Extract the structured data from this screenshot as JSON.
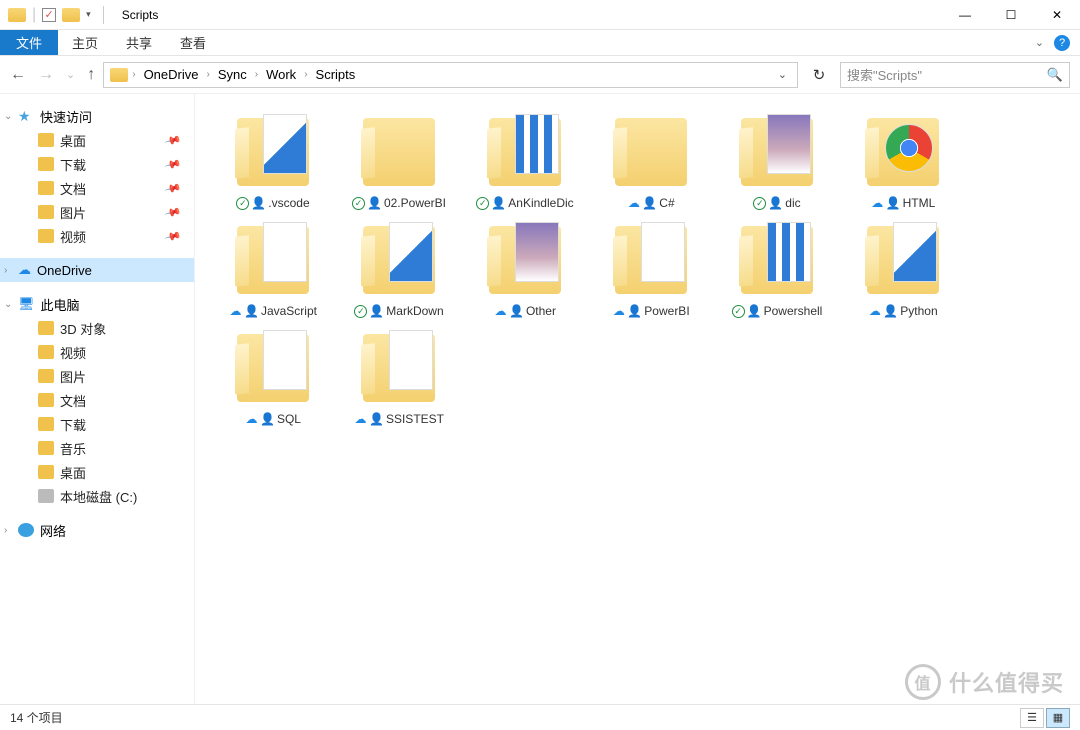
{
  "window": {
    "title": "Scripts"
  },
  "ribbon": {
    "file": "文件",
    "tabs": [
      "主页",
      "共享",
      "查看"
    ]
  },
  "breadcrumb": [
    "OneDrive",
    "Sync",
    "Work",
    "Scripts"
  ],
  "search": {
    "placeholder": "搜索\"Scripts\""
  },
  "sidebar": {
    "quick_access": "快速访问",
    "quick_items": [
      "桌面",
      "下载",
      "文档",
      "图片",
      "视频"
    ],
    "onedrive": "OneDrive",
    "this_pc": "此电脑",
    "pc_items": [
      "3D 对象",
      "视频",
      "图片",
      "文档",
      "下载",
      "音乐",
      "桌面",
      "本地磁盘 (C:)"
    ],
    "network": "网络"
  },
  "items": [
    {
      "name": ".vscode",
      "status": "sync",
      "thumb": "vs"
    },
    {
      "name": "02.PowerBI",
      "status": "sync",
      "thumb": "plain"
    },
    {
      "name": "AnKindleDic",
      "status": "sync",
      "thumb": "stripes"
    },
    {
      "name": "C#",
      "status": "cloud",
      "thumb": "plain"
    },
    {
      "name": "dic",
      "status": "sync",
      "thumb": "img"
    },
    {
      "name": "HTML",
      "status": "cloud",
      "thumb": "chrome"
    },
    {
      "name": "JavaScript",
      "status": "cloud",
      "thumb": "doc"
    },
    {
      "name": "MarkDown",
      "status": "sync",
      "thumb": "vs"
    },
    {
      "name": "Other",
      "status": "cloud",
      "thumb": "img"
    },
    {
      "name": "PowerBI",
      "status": "cloud",
      "thumb": "doc"
    },
    {
      "name": "Powershell",
      "status": "sync",
      "thumb": "stripes"
    },
    {
      "name": "Python",
      "status": "cloud",
      "thumb": "vs"
    },
    {
      "name": "SQL",
      "status": "cloud",
      "thumb": "doc"
    },
    {
      "name": "SSISTEST",
      "status": "cloud",
      "thumb": "doc"
    }
  ],
  "statusbar": {
    "count_label": "14 个项目"
  },
  "watermark": "什么值得买"
}
